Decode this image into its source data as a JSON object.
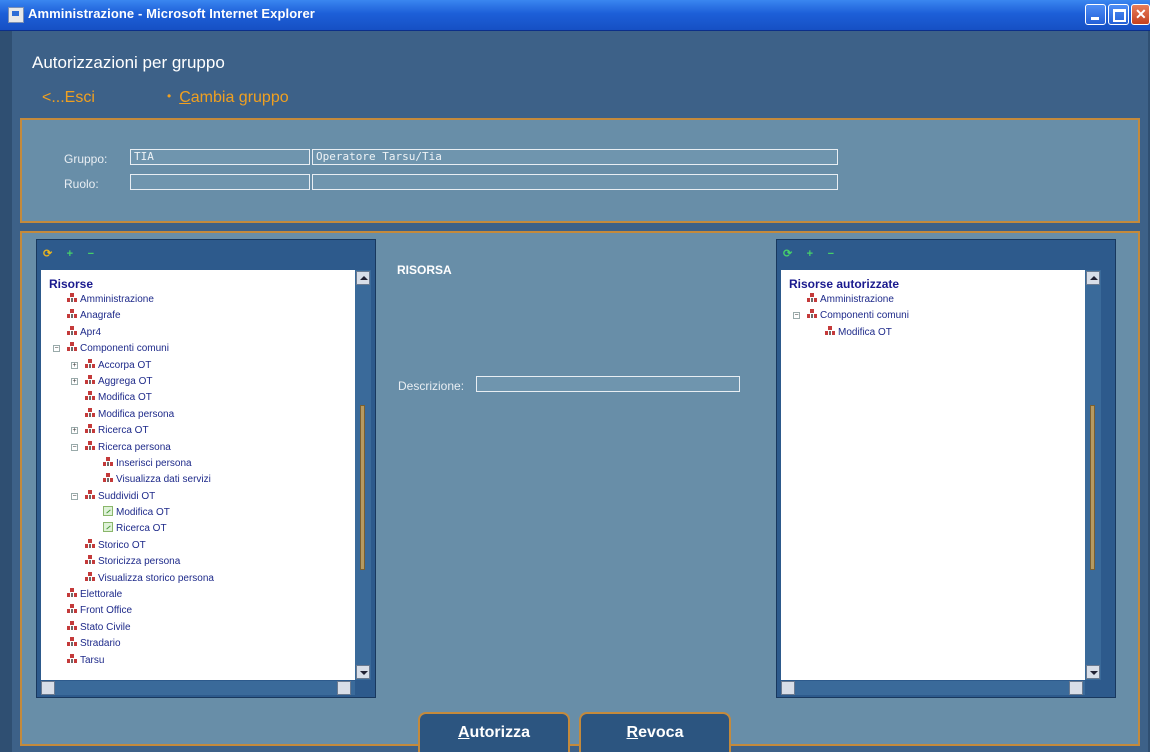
{
  "window": {
    "title": "Amministrazione - Microsoft Internet Explorer"
  },
  "page": {
    "title": "Autorizzazioni per gruppo",
    "nav_exit": "<...Esci",
    "nav_change_group_bullet": "•",
    "nav_change_group_accel": "C",
    "nav_change_group_rest": "ambia gruppo"
  },
  "group": {
    "gruppo_label": "Gruppo:",
    "gruppo_code": "TIA",
    "gruppo_desc": "Operatore Tarsu/Tia",
    "ruolo_label": "Ruolo:",
    "ruolo_code": "",
    "ruolo_desc": ""
  },
  "left_tree": {
    "root": "Risorse",
    "items": [
      {
        "label": "Amministrazione",
        "level": 1,
        "expander": "",
        "icon": "resource-icon"
      },
      {
        "label": "Anagrafe",
        "level": 1,
        "expander": "",
        "icon": "resource-icon"
      },
      {
        "label": "Apr4",
        "level": 1,
        "expander": "",
        "icon": "resource-icon"
      },
      {
        "label": "Componenti comuni",
        "level": 1,
        "expander": "−",
        "icon": "resource-icon"
      },
      {
        "label": "Accorpa OT",
        "level": 2,
        "expander": "+",
        "icon": "resource-icon"
      },
      {
        "label": "Aggrega OT",
        "level": 2,
        "expander": "+",
        "icon": "resource-icon"
      },
      {
        "label": "Modifica OT",
        "level": 2,
        "expander": "",
        "icon": "resource-icon"
      },
      {
        "label": "Modifica persona",
        "level": 2,
        "expander": "",
        "icon": "resource-icon"
      },
      {
        "label": "Ricerca OT",
        "level": 2,
        "expander": "+",
        "icon": "resource-icon"
      },
      {
        "label": "Ricerca persona",
        "level": 2,
        "expander": "−",
        "icon": "resource-icon"
      },
      {
        "label": "Inserisci persona",
        "level": 3,
        "expander": "",
        "icon": "resource-icon"
      },
      {
        "label": "Visualizza dati servizi",
        "level": 3,
        "expander": "",
        "icon": "resource-icon"
      },
      {
        "label": "Suddividi OT",
        "level": 2,
        "expander": "−",
        "icon": "resource-icon"
      },
      {
        "label": "Modifica OT",
        "level": 3,
        "expander": "",
        "icon": "function-icon"
      },
      {
        "label": "Ricerca OT",
        "level": 3,
        "expander": "",
        "icon": "function-icon"
      },
      {
        "label": "Storico OT",
        "level": 2,
        "expander": "",
        "icon": "resource-icon"
      },
      {
        "label": "Storicizza persona",
        "level": 2,
        "expander": "",
        "icon": "resource-icon"
      },
      {
        "label": "Visualizza storico persona",
        "level": 2,
        "expander": "",
        "icon": "resource-icon"
      },
      {
        "label": "Elettorale",
        "level": 1,
        "expander": "",
        "icon": "resource-icon"
      },
      {
        "label": "Front Office",
        "level": 1,
        "expander": "",
        "icon": "resource-icon"
      },
      {
        "label": "Stato Civile",
        "level": 1,
        "expander": "",
        "icon": "resource-icon"
      },
      {
        "label": "Stradario",
        "level": 1,
        "expander": "",
        "icon": "resource-icon"
      },
      {
        "label": "Tarsu",
        "level": 1,
        "expander": "",
        "icon": "resource-icon"
      }
    ]
  },
  "center": {
    "title": "RISORSA",
    "descrizione_label": "Descrizione:",
    "descrizione_value": ""
  },
  "right_tree": {
    "root": "Risorse autorizzate",
    "items": [
      {
        "label": "Amministrazione",
        "level": 1,
        "expander": "",
        "icon": "resource-icon"
      },
      {
        "label": "Componenti comuni",
        "level": 1,
        "expander": "−",
        "icon": "resource-icon"
      },
      {
        "label": "Modifica OT",
        "level": 2,
        "expander": "",
        "icon": "resource-icon"
      }
    ]
  },
  "tabs": {
    "autorizza_accel": "A",
    "autorizza_rest": "utorizza",
    "revoca_accel": "R",
    "revoca_rest": "evoca"
  },
  "colors": {
    "accent_orange": "#c48a3c",
    "link_orange": "#f0a020",
    "panel": "#688ea8",
    "background": "#3d6188"
  }
}
